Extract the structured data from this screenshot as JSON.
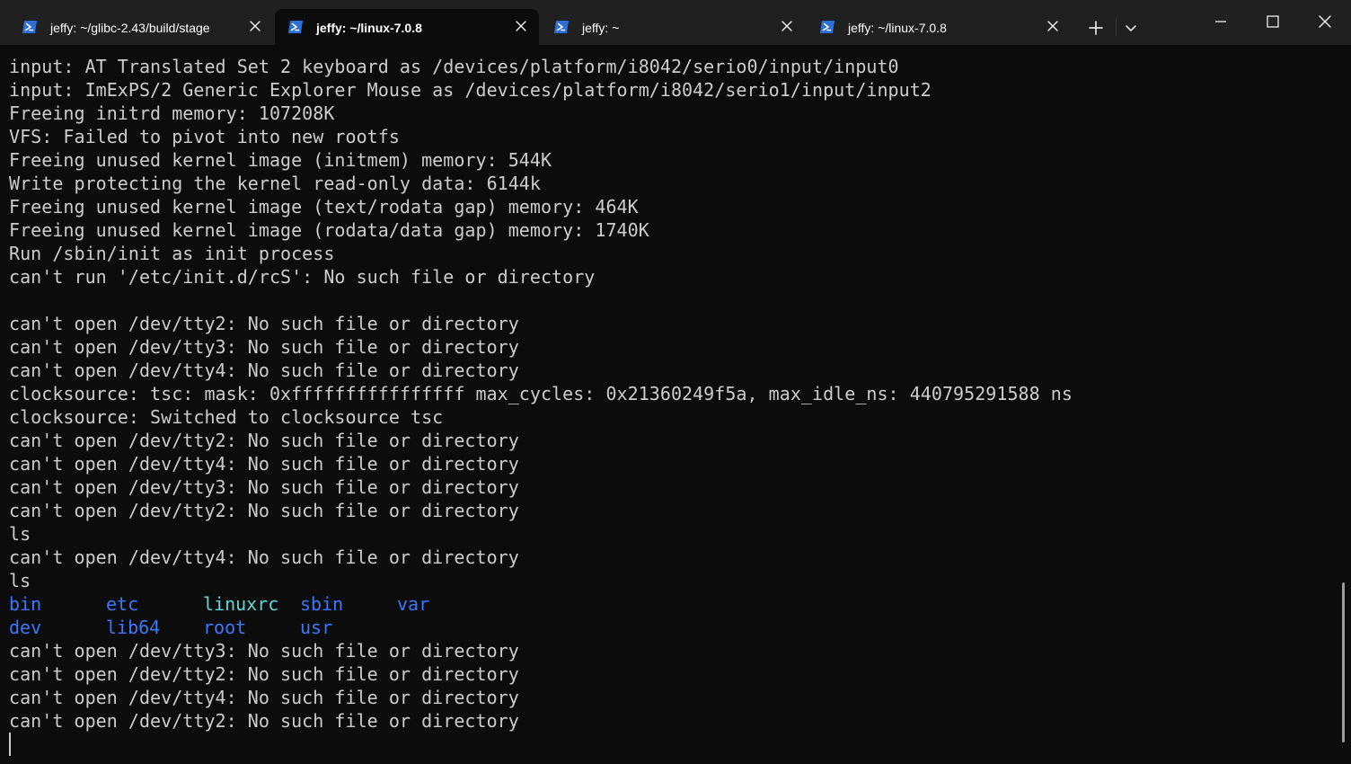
{
  "tabs": [
    {
      "label": "jeffy: ~/glibc-2.43/build/stage",
      "active": false,
      "icon": "powershell-icon"
    },
    {
      "label": "jeffy: ~/linux-7.0.8",
      "active": true,
      "icon": "powershell-icon"
    },
    {
      "label": "jeffy: ~",
      "active": false,
      "icon": "powershell-icon"
    },
    {
      "label": "jeffy: ~/linux-7.0.8",
      "active": false,
      "icon": "powershell-icon"
    }
  ],
  "titlebar_buttons": {
    "new_tab": "plus-icon",
    "dropdown": "chevron-down-icon",
    "minimize": "minimize-icon",
    "maximize": "maximize-icon",
    "close": "close-icon"
  },
  "colors": {
    "background": "#0c0c0c",
    "titlebar": "#202020",
    "text": "#cccccc",
    "dir": "#3b78ff",
    "link": "#61d6d6",
    "powershell_icon": "#2d6fd8"
  },
  "terminal": {
    "lines_before_ls": [
      "input: AT Translated Set 2 keyboard as /devices/platform/i8042/serio0/input/input0",
      "input: ImExPS/2 Generic Explorer Mouse as /devices/platform/i8042/serio1/input/input2",
      "Freeing initrd memory: 107208K",
      "VFS: Failed to pivot into new rootfs",
      "Freeing unused kernel image (initmem) memory: 544K",
      "Write protecting the kernel read-only data: 6144k",
      "Freeing unused kernel image (text/rodata gap) memory: 464K",
      "Freeing unused kernel image (rodata/data gap) memory: 1740K",
      "Run /sbin/init as init process",
      "can't run '/etc/init.d/rcS': No such file or directory",
      "",
      "can't open /dev/tty2: No such file or directory",
      "can't open /dev/tty3: No such file or directory",
      "can't open /dev/tty4: No such file or directory",
      "clocksource: tsc: mask: 0xffffffffffffffff max_cycles: 0x21360249f5a, max_idle_ns: 440795291588 ns",
      "clocksource: Switched to clocksource tsc",
      "can't open /dev/tty2: No such file or directory",
      "can't open /dev/tty4: No such file or directory",
      "can't open /dev/tty3: No such file or directory",
      "can't open /dev/tty2: No such file or directory",
      "ls",
      "can't open /dev/tty4: No such file or directory",
      "ls"
    ],
    "ls_rows": [
      [
        {
          "name": "bin",
          "type": "dir"
        },
        {
          "name": "etc",
          "type": "dir"
        },
        {
          "name": "linuxrc",
          "type": "link"
        },
        {
          "name": "sbin",
          "type": "dir"
        },
        {
          "name": "var",
          "type": "dir"
        }
      ],
      [
        {
          "name": "dev",
          "type": "dir"
        },
        {
          "name": "lib64",
          "type": "dir"
        },
        {
          "name": "root",
          "type": "dir"
        },
        {
          "name": "usr",
          "type": "dir"
        }
      ]
    ],
    "lines_after_ls": [
      "can't open /dev/tty3: No such file or directory",
      "can't open /dev/tty2: No such file or directory",
      "can't open /dev/tty4: No such file or directory",
      "can't open /dev/tty2: No such file or directory"
    ]
  }
}
